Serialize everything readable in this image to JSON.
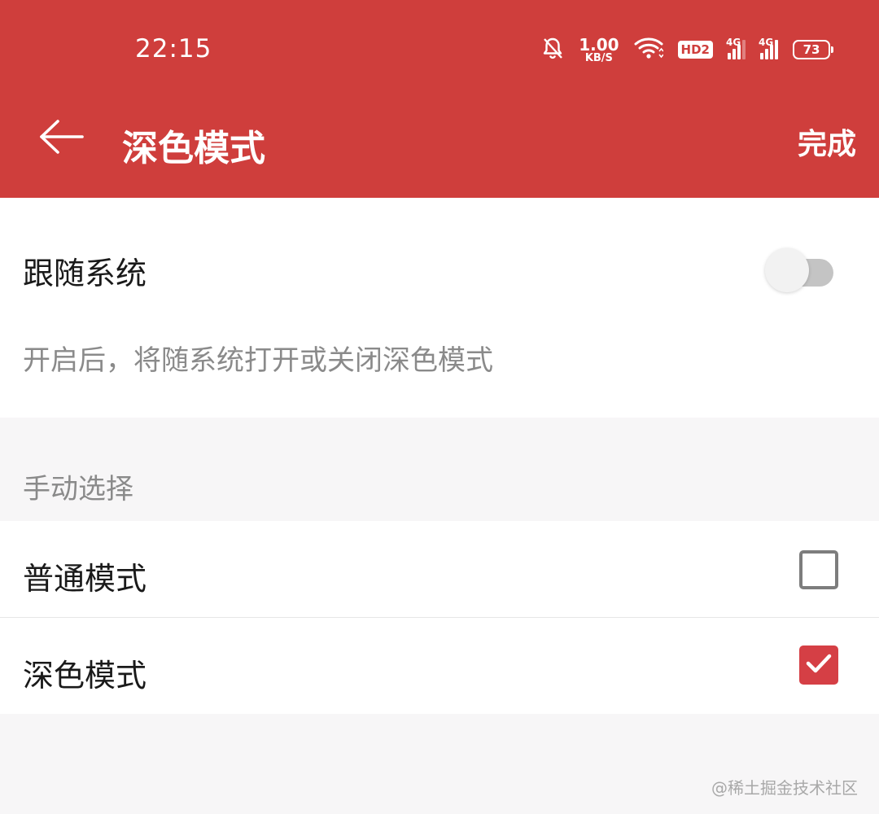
{
  "status_bar": {
    "time": "22:15",
    "net_speed_value": "1.00",
    "net_speed_unit": "KB/S",
    "hd_badge": "HD2",
    "signal1_label": "4G",
    "signal2_label": "4G",
    "battery_level": "73",
    "icons": [
      "bell-off-icon",
      "wifi-icon",
      "signal-icon",
      "battery-icon"
    ]
  },
  "app_bar": {
    "title": "深色模式",
    "done_label": "完成",
    "back_icon": "arrow-left-icon"
  },
  "follow_system": {
    "label": "跟随系统",
    "description": "开启后，将随系统打开或关闭深色模式",
    "enabled": false
  },
  "manual": {
    "header": "手动选择",
    "options": [
      {
        "label": "普通模式",
        "checked": false
      },
      {
        "label": "深色模式",
        "checked": true
      }
    ]
  },
  "watermark": "@稀土掘金技术社区",
  "colors": {
    "brand_red": "#cf3e3c",
    "check_red": "#d53f45",
    "background": "#f7f6f7"
  }
}
